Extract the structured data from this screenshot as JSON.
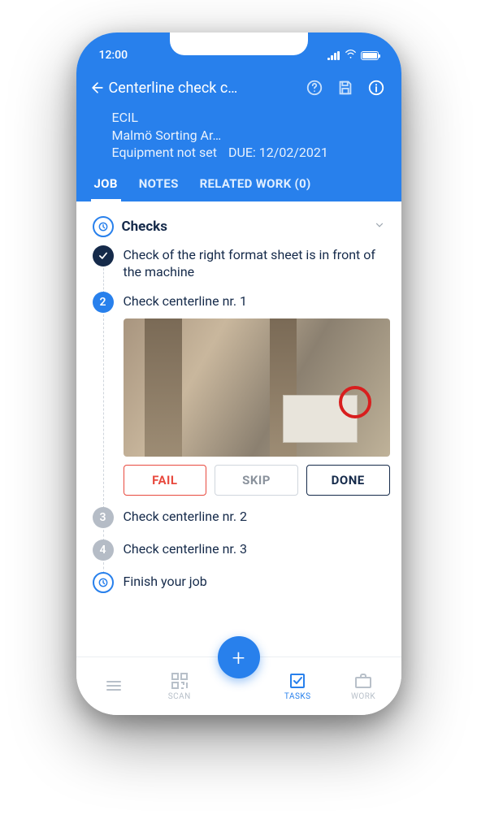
{
  "statusbar": {
    "time": "12:00"
  },
  "header": {
    "title": "Centerline check c…",
    "meta": {
      "org": "ECIL",
      "location": "Malmö Sorting Ar…",
      "equipment": "Equipment not set",
      "due_label": "DUE:",
      "due_date": "12/02/2021"
    }
  },
  "tabs": {
    "job": "JOB",
    "notes": "NOTES",
    "related": "RELATED WORK (0)"
  },
  "section": {
    "title": "Checks"
  },
  "steps": [
    {
      "num": "✓",
      "text": "Check of the right format sheet is in front of the machine"
    },
    {
      "num": "2",
      "text": "Check centerline nr. 1"
    },
    {
      "num": "3",
      "text": "Check centerline nr. 2"
    },
    {
      "num": "4",
      "text": "Check centerline nr. 3"
    },
    {
      "num": "⏱",
      "text": "Finish your job"
    }
  ],
  "buttons": {
    "fail": "FAIL",
    "skip": "SKIP",
    "done": "DONE"
  },
  "nav": {
    "scan": "SCAN",
    "tasks": "TASKS",
    "work": "WORK"
  }
}
